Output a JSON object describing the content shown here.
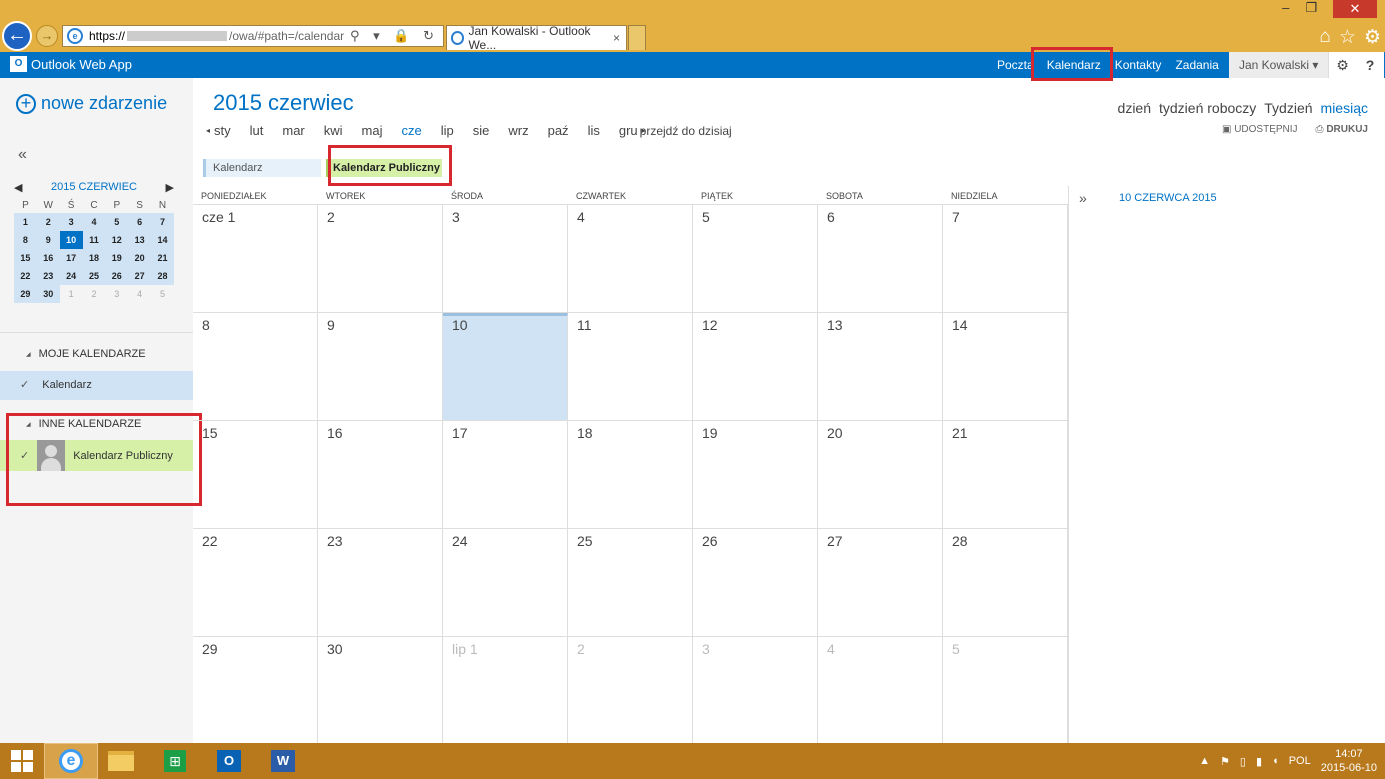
{
  "browser": {
    "url_prefix": "https://",
    "url_suffix": "/owa/#path=/calendar",
    "tab_title": "Jan Kowalski - Outlook We...",
    "tab_close": "×",
    "addr_icons": "⚲ ▾ 🔒 ↻"
  },
  "owa": {
    "app_name": "Outlook Web App",
    "nav": [
      "Poczta",
      "Kalendarz",
      "Kontakty",
      "Zadania"
    ],
    "user": "Jan Kowalski ▾",
    "settings_glyph": "⚙",
    "help_glyph": "?"
  },
  "left": {
    "new_event": "nowe zdarzenie",
    "collapse": "«",
    "minical": {
      "title": "2015 CZERWIEC",
      "prev": "◀",
      "next": "▶",
      "dow": [
        "P",
        "W",
        "Ś",
        "C",
        "P",
        "S",
        "N"
      ],
      "days": [
        {
          "d": "1"
        },
        {
          "d": "2"
        },
        {
          "d": "3"
        },
        {
          "d": "4"
        },
        {
          "d": "5"
        },
        {
          "d": "6"
        },
        {
          "d": "7"
        },
        {
          "d": "8"
        },
        {
          "d": "9"
        },
        {
          "d": "10",
          "today": true
        },
        {
          "d": "11"
        },
        {
          "d": "12"
        },
        {
          "d": "13"
        },
        {
          "d": "14"
        },
        {
          "d": "15"
        },
        {
          "d": "16"
        },
        {
          "d": "17"
        },
        {
          "d": "18"
        },
        {
          "d": "19"
        },
        {
          "d": "20"
        },
        {
          "d": "21"
        },
        {
          "d": "22"
        },
        {
          "d": "23"
        },
        {
          "d": "24"
        },
        {
          "d": "25"
        },
        {
          "d": "26"
        },
        {
          "d": "27"
        },
        {
          "d": "28"
        },
        {
          "d": "29"
        },
        {
          "d": "30"
        },
        {
          "d": "1",
          "other": true
        },
        {
          "d": "2",
          "other": true
        },
        {
          "d": "3",
          "other": true
        },
        {
          "d": "4",
          "other": true
        },
        {
          "d": "5",
          "other": true
        }
      ]
    },
    "my_calendars": "MOJE KALENDARZE",
    "my_calendar_item": "Kalendarz",
    "other_calendars": "INNE KALENDARZE",
    "other_calendar_item": "Kalendarz Publiczny",
    "check": "✓"
  },
  "main": {
    "title": "2015 czerwiec",
    "months_prev": "◂",
    "months_next": "▸",
    "months": [
      "sty",
      "lut",
      "mar",
      "kwi",
      "maj",
      "cze",
      "lip",
      "sie",
      "wrz",
      "paź",
      "lis",
      "gru"
    ],
    "current_month_index": 5,
    "goto_today": "przejdź do dzisiaj",
    "views": [
      "dzień",
      "tydzień roboczy",
      "Tydzień",
      "miesiąc"
    ],
    "current_view_index": 3,
    "share": "UDOSTĘPNIJ",
    "print": "DRUKUJ",
    "cal_tab1": "Kalendarz",
    "cal_tab2": "Kalendarz Publiczny",
    "weekdays": [
      "PONIEDZIAŁEK",
      "WTOREK",
      "ŚRODA",
      "CZWARTEK",
      "PIĄTEK",
      "SOBOTA",
      "NIEDZIELA"
    ],
    "days": [
      {
        "d": "cze 1"
      },
      {
        "d": "2"
      },
      {
        "d": "3"
      },
      {
        "d": "4"
      },
      {
        "d": "5"
      },
      {
        "d": "6"
      },
      {
        "d": "7"
      },
      {
        "d": "8"
      },
      {
        "d": "9"
      },
      {
        "d": "10",
        "today": true
      },
      {
        "d": "11"
      },
      {
        "d": "12"
      },
      {
        "d": "13"
      },
      {
        "d": "14"
      },
      {
        "d": "15"
      },
      {
        "d": "16"
      },
      {
        "d": "17"
      },
      {
        "d": "18"
      },
      {
        "d": "19"
      },
      {
        "d": "20"
      },
      {
        "d": "21"
      },
      {
        "d": "22"
      },
      {
        "d": "23"
      },
      {
        "d": "24"
      },
      {
        "d": "25"
      },
      {
        "d": "26"
      },
      {
        "d": "27"
      },
      {
        "d": "28"
      },
      {
        "d": "29"
      },
      {
        "d": "30"
      },
      {
        "d": "lip 1",
        "other": true
      },
      {
        "d": "2",
        "other": true
      },
      {
        "d": "3",
        "other": true
      },
      {
        "d": "4",
        "other": true
      },
      {
        "d": "5",
        "other": true
      }
    ],
    "expand": "»",
    "selected_date": "10 CZERWCA 2015"
  },
  "taskbar": {
    "lang": "POL",
    "time": "14:07",
    "date": "2015-06-10"
  },
  "colors": {
    "owa_blue": "#0072c6",
    "highlight_red": "#d7282f",
    "public_green": "#d6f0a8",
    "taskbar": "#b8791c"
  }
}
